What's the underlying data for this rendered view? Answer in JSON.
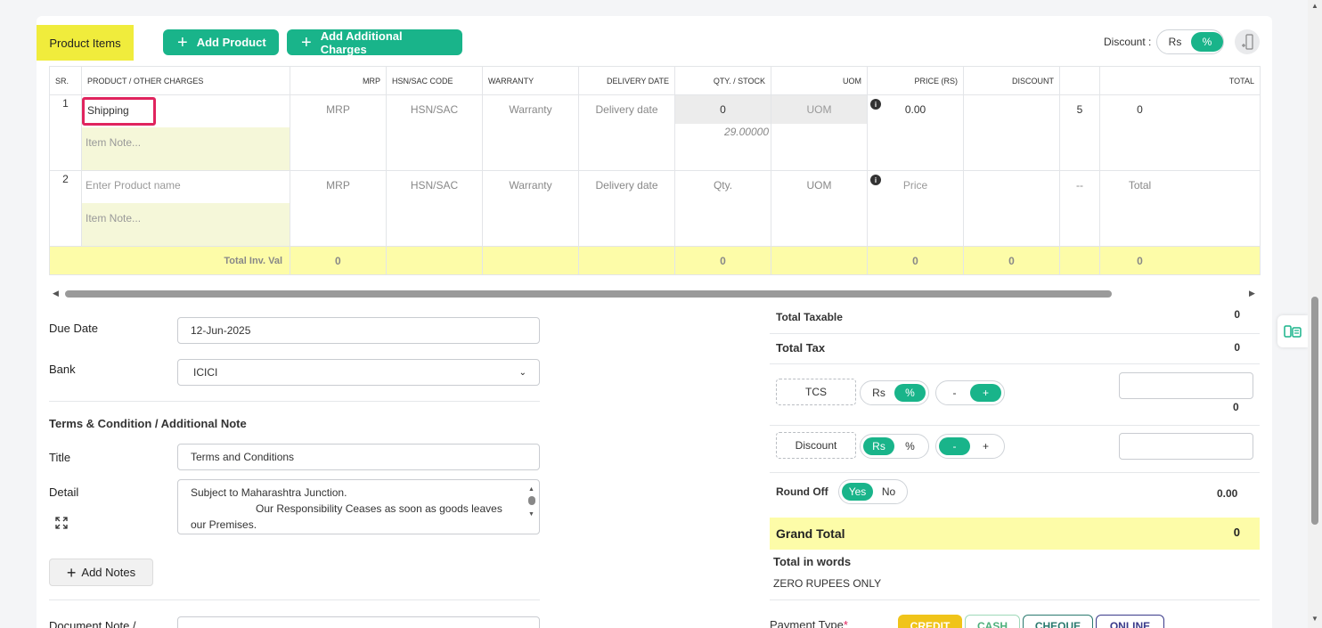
{
  "header": {
    "section_title": "Product Items",
    "add_product": "Add Product",
    "add_charges": "Add Additional Charges",
    "discount_label": "Discount :",
    "discount_rs": "Rs",
    "discount_pct": "%"
  },
  "table": {
    "columns": [
      "SR.",
      "PRODUCT / OTHER CHARGES",
      "MRP",
      "HSN/SAC CODE",
      "WARRANTY",
      "DELIVERY DATE",
      "QTY. / STOCK",
      "UOM",
      "PRICE (RS)",
      "DISCOUNT",
      "",
      "TOTAL"
    ],
    "rows": [
      {
        "sr": "1",
        "product": "Shipping",
        "note_placeholder": "Item Note...",
        "mrp": "MRP",
        "hsn": "HSN/SAC",
        "warranty": "Warranty",
        "delivery": "Delivery date",
        "qty": "0",
        "stock": "29.00000",
        "uom": "UOM",
        "price": "0.00",
        "discount": "",
        "tax": "5",
        "total": "0"
      },
      {
        "sr": "2",
        "product_placeholder": "Enter Product name",
        "note_placeholder": "Item Note...",
        "mrp": "MRP",
        "hsn": "HSN/SAC",
        "warranty": "Warranty",
        "delivery": "Delivery date",
        "qty": "Qty.",
        "uom": "UOM",
        "price": "Price",
        "discount": "",
        "tax": "--",
        "total": "Total"
      }
    ],
    "totals": {
      "label": "Total Inv. Val",
      "mrp": "0",
      "qty": "0",
      "price": "0",
      "discount": "0",
      "total": "0"
    }
  },
  "form": {
    "due_date_label": "Due Date",
    "due_date": "12-Jun-2025",
    "bank_label": "Bank",
    "bank": "ICICI",
    "terms_heading": "Terms & Condition / Additional Note",
    "title_label": "Title",
    "title_value": "Terms and Conditions",
    "detail_label": "Detail",
    "detail_line1": "Subject to Maharashtra Junction.",
    "detail_line2": "Our Responsibility Ceases as soon as goods leaves",
    "detail_line3": "our Premises.",
    "add_notes": "Add Notes",
    "doc_note_label": "Document Note /"
  },
  "summary": {
    "total_taxable_label": "Total Taxable",
    "total_taxable": "0",
    "total_tax_label": "Total Tax",
    "total_tax": "0",
    "tcs_label": "TCS",
    "tcs_value": "0",
    "discount_label": "Discount",
    "rs": "Rs",
    "pct": "%",
    "minus": "-",
    "plus": "+",
    "round_off_label": "Round Off",
    "yes": "Yes",
    "no": "No",
    "round_off_value": "0.00",
    "grand_total_label": "Grand Total",
    "grand_total": "0",
    "total_words_label": "Total in words",
    "total_words": "ZERO RUPEES ONLY",
    "payment_type_label": "Payment Type",
    "payment_types": [
      "CREDIT",
      "CASH",
      "CHEQUE",
      "ONLINE"
    ]
  },
  "colors": {
    "accent": "#19b48a",
    "highlight": "#fdfca8",
    "label_yellow": "#f0ec3c",
    "required": "#e0245e"
  }
}
